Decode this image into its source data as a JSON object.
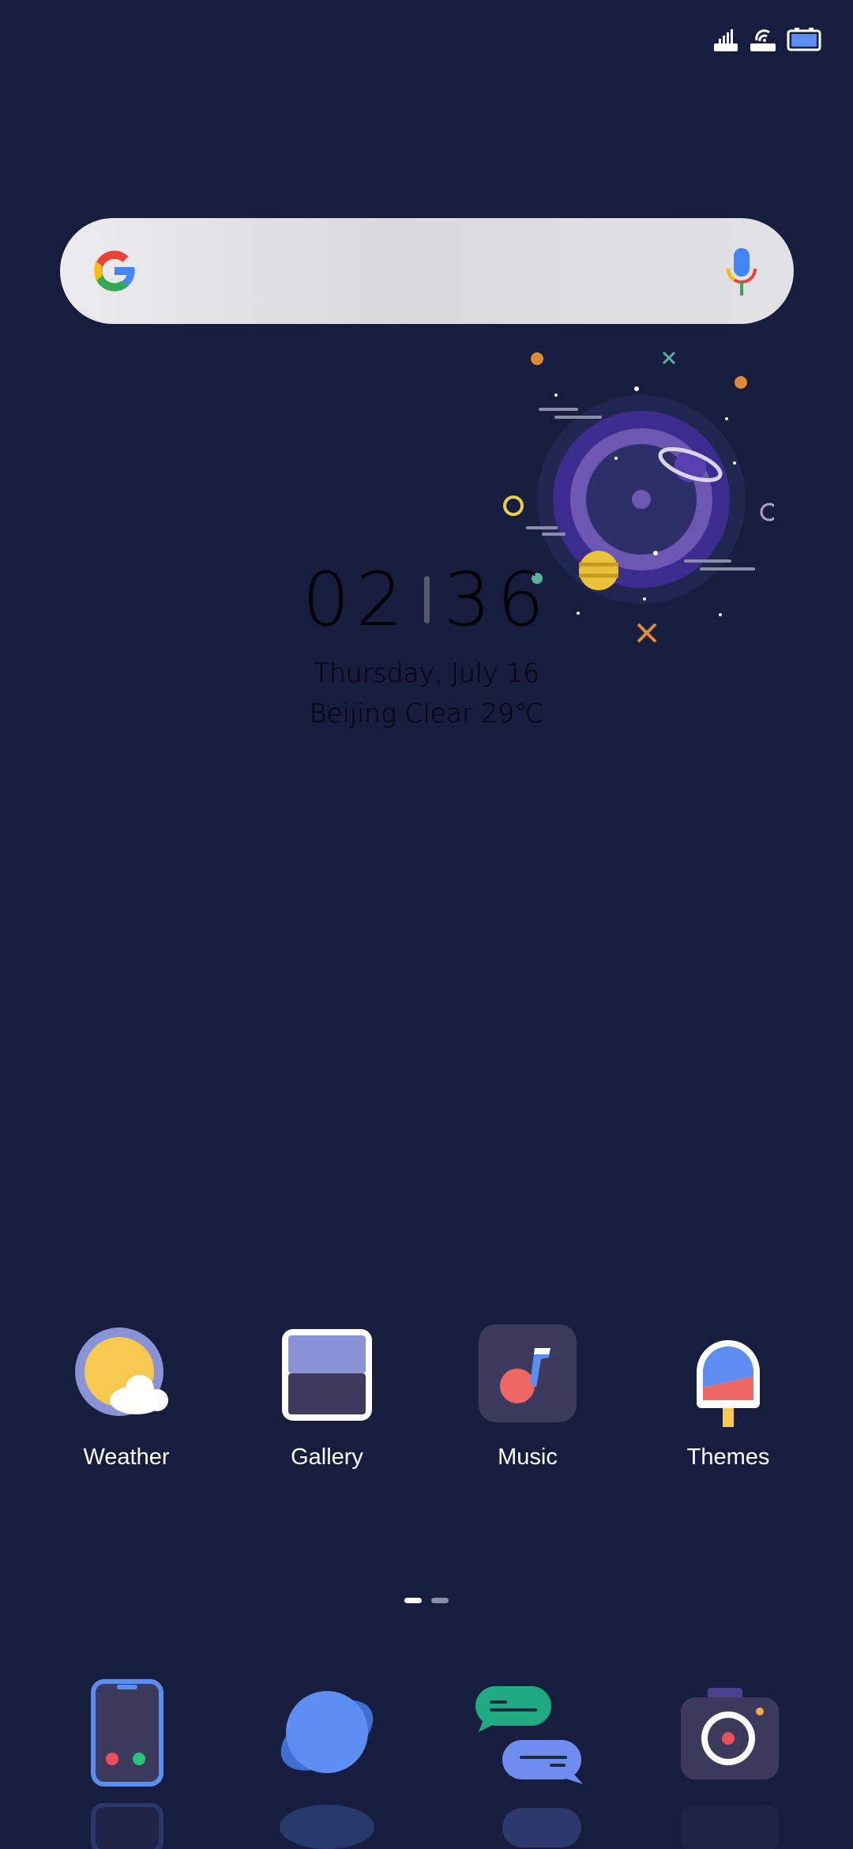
{
  "status_bar": {
    "icons": [
      "signal-icon",
      "wifi-icon",
      "battery-icon"
    ]
  },
  "search_widget": {
    "logo": "google-g-icon",
    "voice": "microphone-icon"
  },
  "clock_widget": {
    "hours": "02",
    "minutes": "36",
    "date": "Thursday, July 16",
    "weather": "Beijing Clear 29℃"
  },
  "apps": [
    {
      "label": "Weather",
      "icon": "weather-icon"
    },
    {
      "label": "Gallery",
      "icon": "gallery-icon"
    },
    {
      "label": "Music",
      "icon": "music-icon"
    },
    {
      "label": "Themes",
      "icon": "themes-icon"
    }
  ],
  "page_indicator": {
    "pages": 2,
    "current": 1
  },
  "dock": [
    {
      "icon": "phone-icon"
    },
    {
      "icon": "browser-icon"
    },
    {
      "icon": "messages-icon"
    },
    {
      "icon": "camera-icon"
    }
  ],
  "colors": {
    "background": "#161d3f",
    "accent_blue": "#5b8ef0",
    "accent_purple": "#6c4fc7"
  }
}
